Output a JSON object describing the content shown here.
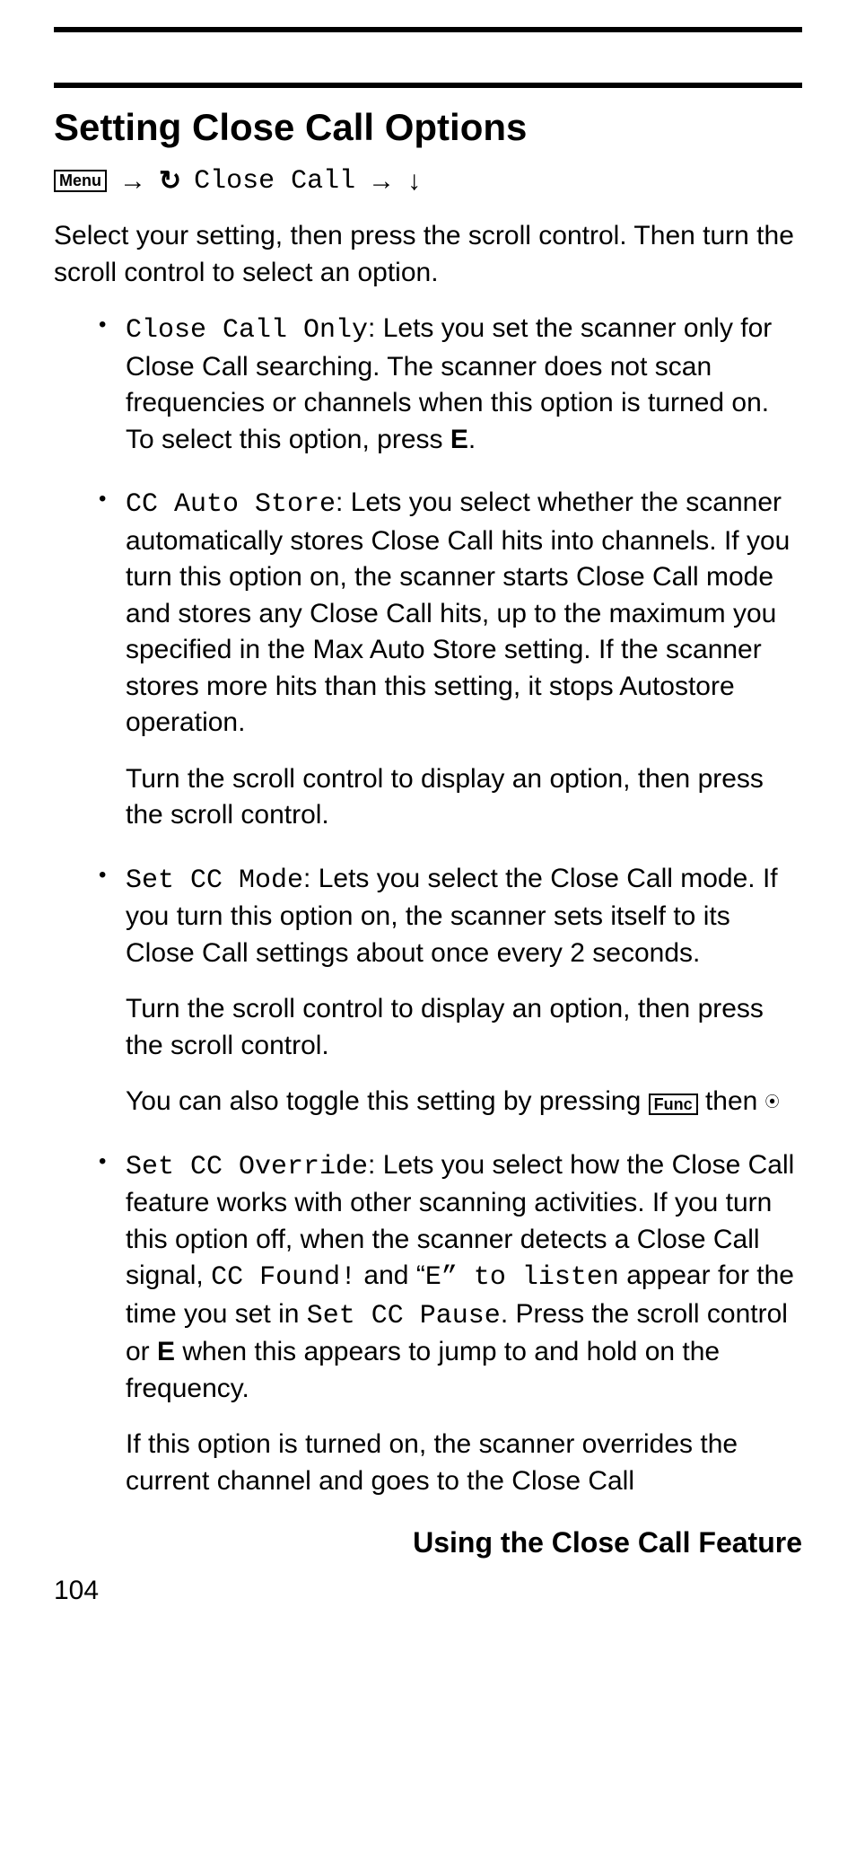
{
  "heading": "Setting Close Call Options",
  "nav": {
    "menu_key": "Menu",
    "close_call": "Close Call"
  },
  "intro": "Select your setting, then press the scroll control. Then turn the scroll control to select an option.",
  "items": {
    "cc_only": {
      "label": "Close Call Only",
      "text_a": ": Lets you set the scanner only for Close Call searching. The scanner does not scan frequencies or channels when this option is turned on. To select this option, press ",
      "key": "E",
      "text_b": "."
    },
    "cc_auto": {
      "label": "CC Auto Store",
      "text": ": Lets you select whether the scanner automatically stores Close Call hits into channels. If you turn this option on, the scanner starts Close Call mode and stores any Close Call hits, up to the maximum you specified in the Max Auto Store setting. If the scanner stores more hits than this setting, it stops Autostore operation.",
      "sub": "Turn the scroll control to display an option, then press the scroll control."
    },
    "cc_mode": {
      "label": "Set CC Mode",
      "text": ": Lets you select the Close Call mode. If you turn this option on, the scanner sets itself to its Close Call settings about once every 2 seconds.",
      "sub1": "Turn the scroll control to display an option, then press the scroll control.",
      "sub2_a": "You can also toggle this setting by pressing ",
      "func_key": "Func",
      "sub2_b": " then "
    },
    "cc_override": {
      "label": "Set CC Override",
      "text_a": ": Lets you select how the Close Call feature works with other scanning activities. If you turn this option off, when the scanner detects a Close Call signal, ",
      "cc_found": "CC Found!",
      "text_b": " and “",
      "e_listen": "E” to listen",
      "text_c": " appear for the time you set in ",
      "set_pause": "Set CC Pause",
      "text_d": ". Press the scroll control or ",
      "key": "E",
      "text_e": " when this appears to jump to and hold on the frequency.",
      "sub": "If this option is turned on, the scanner overrides the current channel and goes to the Close Call"
    }
  },
  "footer_title": "Using the Close Call Feature",
  "page_number": "104"
}
